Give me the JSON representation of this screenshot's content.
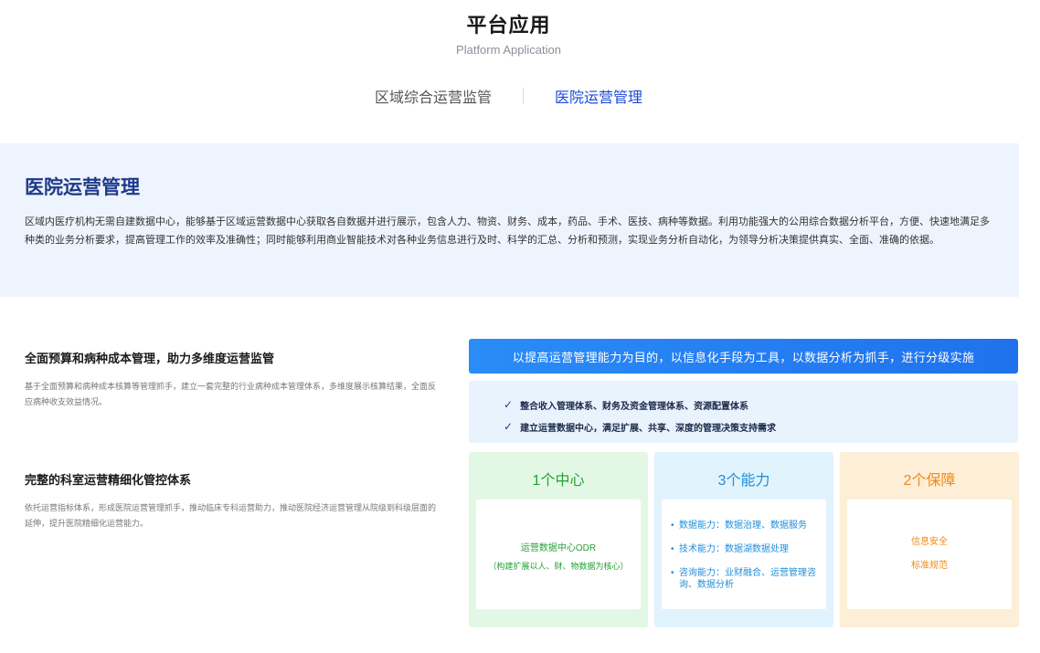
{
  "header": {
    "title": "平台应用",
    "subtitle": "Platform Application"
  },
  "tabs": [
    {
      "label": "区域综合运营监管",
      "active": false
    },
    {
      "label": "医院运营管理",
      "active": true
    }
  ],
  "intro": {
    "title": "医院运营管理",
    "text": "区域内医疗机构无需自建数据中心，能够基于区域运营数据中心获取各自数据并进行展示，包含人力、物资、财务、成本，药品、手术、医技、病种等数据。利用功能强大的公用综合数据分析平台，方便、快速地满足多种类的业务分析要求，提高管理工作的效率及准确性；同时能够利用商业智能技术对各种业务信息进行及时、科学的汇总、分析和预测，实现业务分析自动化，为领导分析决策提供真实、全面、准确的依据。"
  },
  "features": [
    {
      "title": "全面预算和病种成本管理，助力多维度运营监管",
      "desc": "基于全面预算和病种成本核算等管理抓手，建立一套完整的行业病种成本管理体系，多维度展示核算结果，全面反应病种收支效益情况。"
    },
    {
      "title": "完整的科室运营精细化管控体系",
      "desc": "依托运营指标体系，形成医院运营管理抓手，推动临床专科运营助力，推动医院经济运营管理从院级到科级层面的延伸，提升医院精细化运营能力。"
    }
  ],
  "banner": "以提高运营管理能力为目的，以信息化手段为工具，以数据分析为抓手，进行分级实施",
  "checks": [
    "整合收入管理体系、财务及资金管理体系、资源配置体系",
    "建立运营数据中心，满足扩展、共享、深度的管理决策支持需求"
  ],
  "cards": {
    "center": {
      "title": "1个中心",
      "main": "运营数据中心ODR",
      "sub": "（构建扩展以人、财、物数据为核心）"
    },
    "ability": {
      "title": "3个能力",
      "bullet": "•",
      "items": [
        "数据能力：数据治理、数据服务",
        "技术能力：数据湖数据处理",
        "咨询能力：业财融合、运营管理咨询、数据分析"
      ]
    },
    "guarantee": {
      "title": "2个保障",
      "items": [
        "信息安全",
        "标准规范"
      ]
    }
  },
  "icons": {
    "check": "✓"
  },
  "colors": {
    "accent_blue": "#1c48d8",
    "intro_bg": "#eef4fd",
    "green": "#23a136",
    "blue": "#1f8fd8",
    "orange": "#f08a14"
  }
}
